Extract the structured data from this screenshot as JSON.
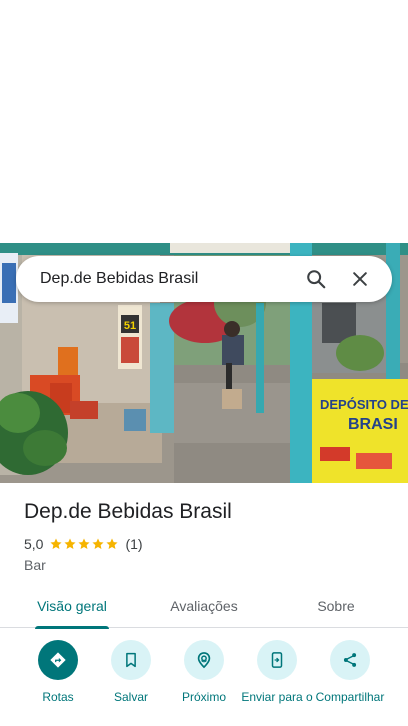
{
  "search": {
    "query": "Dep.de Bebidas Brasil"
  },
  "photo": {
    "sign_number": "51",
    "banner_line1": "DEPÓSITO DE B",
    "banner_line2": "BRASI"
  },
  "place": {
    "title": "Dep.de Bebidas Brasil",
    "rating": "5,0",
    "stars": 5,
    "reviews_count": "(1)",
    "category": "Bar"
  },
  "tabs": [
    {
      "label": "Visão geral",
      "active": true
    },
    {
      "label": "Avaliações",
      "active": false
    },
    {
      "label": "Sobre",
      "active": false
    }
  ],
  "actions": [
    {
      "label": "Rotas",
      "icon": "directions-icon"
    },
    {
      "label": "Salvar",
      "icon": "bookmark-icon"
    },
    {
      "label": "Próximo",
      "icon": "nearby-icon"
    },
    {
      "label": "Enviar para o",
      "icon": "send-to-phone-icon"
    },
    {
      "label": "Compartilhar",
      "icon": "share-icon"
    }
  ],
  "colors": {
    "accent": "#00767a",
    "accent_light": "#d9f3f6",
    "star": "#f6b400"
  }
}
